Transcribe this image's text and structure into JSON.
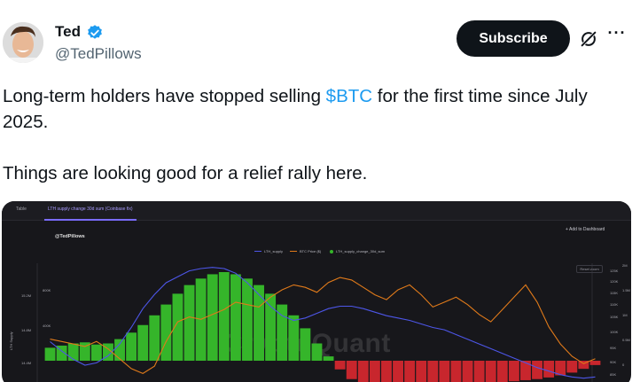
{
  "post": {
    "author_name": "Ted",
    "handle": "@TedPillows",
    "subscribe_label": "Subscribe",
    "more_label": "···",
    "text_before": "Long-term holders have stopped selling ",
    "cashtag": "$BTC",
    "text_after": " for the first time since July 2025.",
    "text_line2": "Things are looking good for a relief rally here."
  },
  "media": {
    "tabs": [
      "Table",
      "LTH supply change 30d sum (Coinbase fix)"
    ],
    "chart_handle": "@TedPillows",
    "add_to_dashboard": "+ Add to Dashboard",
    "reset_zoom": "Reset zoom",
    "watermark": "CryptoQuant",
    "colors": {
      "background": "#17171b",
      "lth_supply": "#4d56e8",
      "btc_price": "#e07a1a",
      "positive_bar": "#35b52a",
      "negative_bar": "#c8262d"
    }
  },
  "chart_data": {
    "type": "bar",
    "legend": [
      "LTH_supply",
      "BTC Price ($)",
      "LTH_supply_change_30d_sum"
    ],
    "left_axis_ticks": [
      "15.2M",
      "14.8M",
      "14.4M"
    ],
    "left_axis_title": "LTH Supply",
    "inner_axis_ticks": [
      "800K",
      "400K"
    ],
    "right_axis_ticks": [
      "125K",
      "120K",
      "115K",
      "110K",
      "105K",
      "100K",
      "95K",
      "90K",
      "85K"
    ],
    "right_range_ticks": [
      "2M",
      "1.5M",
      "1M",
      "0.5M",
      "0"
    ],
    "series": [
      {
        "name": "LTH_supply_change_30d_sum",
        "values": [
          120,
          140,
          160,
          170,
          150,
          160,
          200,
          260,
          330,
          420,
          520,
          620,
          700,
          760,
          800,
          820,
          800,
          760,
          700,
          620,
          520,
          420,
          300,
          160,
          40,
          -80,
          -170,
          -210,
          -230,
          -240,
          -240,
          -235,
          -230,
          -240,
          -245,
          -240,
          -235,
          -225,
          -215,
          -200,
          -190,
          -180,
          -170,
          -155,
          -135,
          -110,
          -75,
          -40
        ]
      },
      {
        "name": "BTC Price ($)",
        "values": [
          96,
          95,
          94,
          93,
          95,
          92,
          88,
          84,
          82,
          85,
          95,
          103,
          105,
          104,
          106,
          108,
          111,
          110,
          109,
          113,
          116,
          118,
          117,
          115,
          119,
          121,
          120,
          117,
          114,
          112,
          116,
          118,
          114,
          109,
          111,
          113,
          110,
          106,
          103,
          108,
          113,
          118,
          111,
          101,
          94,
          89,
          86,
          88
        ]
      },
      {
        "name": "LTH_supply",
        "values": [
          14.7,
          14.62,
          14.55,
          14.5,
          14.52,
          14.58,
          14.68,
          14.82,
          14.98,
          15.1,
          15.2,
          15.25,
          15.3,
          15.32,
          15.33,
          15.32,
          15.28,
          15.2,
          15.1,
          15.0,
          14.92,
          14.88,
          14.9,
          14.94,
          14.98,
          15.0,
          15.0,
          14.98,
          14.95,
          14.92,
          14.9,
          14.88,
          14.85,
          14.82,
          14.8,
          14.76,
          14.72,
          14.68,
          14.64,
          14.6,
          14.56,
          14.52,
          14.48,
          14.45,
          14.42,
          14.4,
          14.39,
          14.4
        ]
      }
    ]
  }
}
